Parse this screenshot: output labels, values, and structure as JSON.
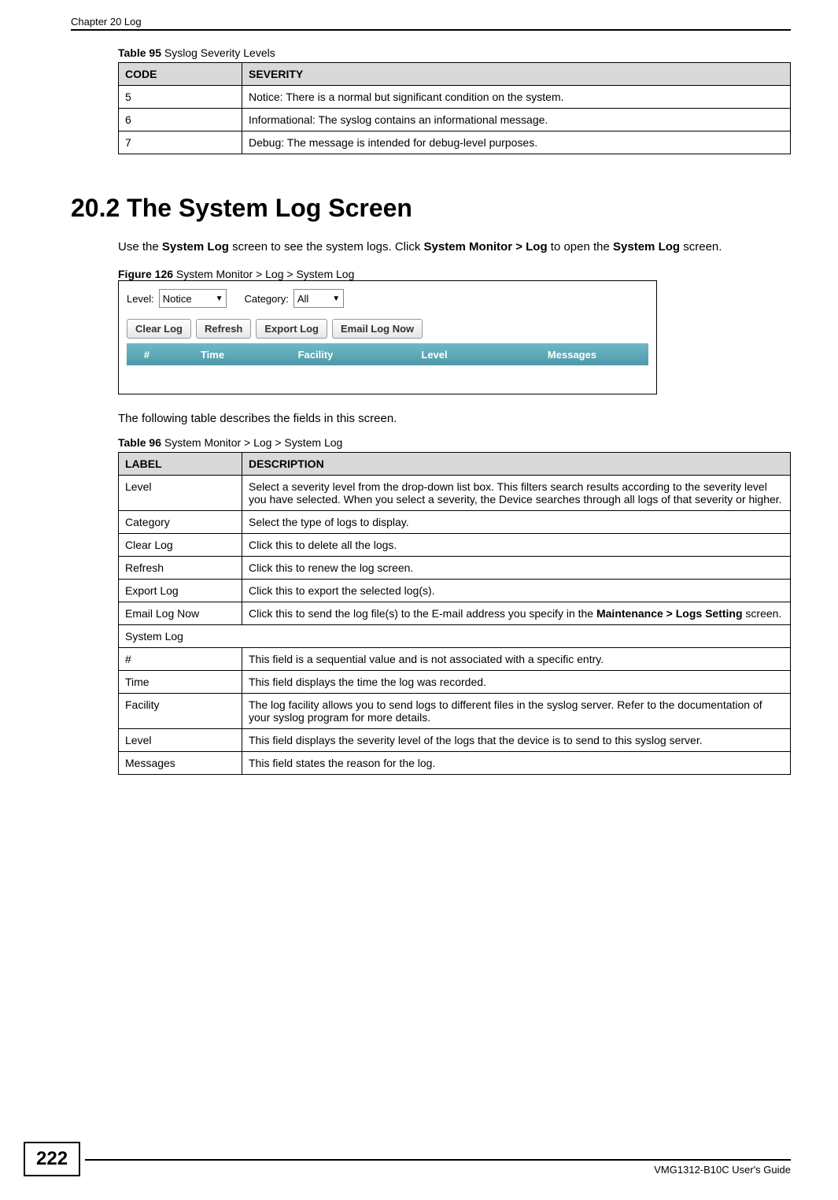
{
  "header": {
    "chapter": "Chapter 20 Log"
  },
  "table95": {
    "caption_bold": "Table 95",
    "caption_rest": "   Syslog Severity Levels",
    "head_code": "CODE",
    "head_severity": "SEVERITY",
    "rows": [
      {
        "code": "5",
        "sev": "Notice: There is a normal but significant condition on the system."
      },
      {
        "code": "6",
        "sev": "Informational: The syslog contains an informational message."
      },
      {
        "code": "7",
        "sev": "Debug: The message is intended for debug-level purposes."
      }
    ]
  },
  "section": {
    "title": "20.2  The System Log Screen"
  },
  "para1": {
    "t1": "Use the ",
    "b1": "System Log",
    "t2": " screen to see the system logs. Click ",
    "b2": "System Monitor > Log",
    "t3": " to open the ",
    "b3": "System Log",
    "t4": " screen."
  },
  "figure": {
    "caption_bold": "Figure 126",
    "caption_rest": "   System Monitor > Log > System Log",
    "level_label": "Level:",
    "level_value": "Notice",
    "category_label": "Category:",
    "category_value": "All",
    "btn_clear": "Clear Log",
    "btn_refresh": "Refresh",
    "btn_export": "Export Log",
    "btn_email": "Email Log Now",
    "col_hash": "#",
    "col_time": "Time",
    "col_facility": "Facility",
    "col_level": "Level",
    "col_messages": "Messages"
  },
  "para2": "The following table describes the fields in this screen.",
  "table96": {
    "caption_bold": "Table 96",
    "caption_rest": "   System Monitor > Log > System Log",
    "head_label": "LABEL",
    "head_desc": "DESCRIPTION",
    "rows": [
      {
        "label": "Level",
        "desc": "Select a severity level from the drop-down list box. This filters search results according to the severity level you have selected. When you select a severity, the Device searches through all logs of that severity or higher."
      },
      {
        "label": "Category",
        "desc": "Select the type of logs to display."
      },
      {
        "label": "Clear Log",
        "desc": "Click this to delete all the logs."
      },
      {
        "label": "Refresh",
        "desc": "Click this to renew the log screen."
      },
      {
        "label": "Export Log",
        "desc": "Click this to export the selected log(s)."
      }
    ],
    "email_row": {
      "label": "Email Log Now",
      "d1": "Click this to send the log file(s) to the E-mail address you specify in the ",
      "b1": "Maintenance > Logs Setting",
      "d2": " screen."
    },
    "syslog_header": "System Log",
    "rows2": [
      {
        "label": "#",
        "desc": "This field is a sequential value and is not associated with a specific entry."
      },
      {
        "label": "Time",
        "desc": "This field displays the time the log was recorded."
      },
      {
        "label": "Facility",
        "desc": "The log facility allows you to send logs to different files in the syslog server. Refer to the documentation of your syslog program for more details."
      },
      {
        "label": "Level",
        "desc": "This field displays the severity level of the logs that the device is to send to this syslog server."
      },
      {
        "label": "Messages",
        "desc": "This field states the reason for the log."
      }
    ]
  },
  "footer": {
    "page": "222",
    "guide": "VMG1312-B10C User's Guide"
  }
}
